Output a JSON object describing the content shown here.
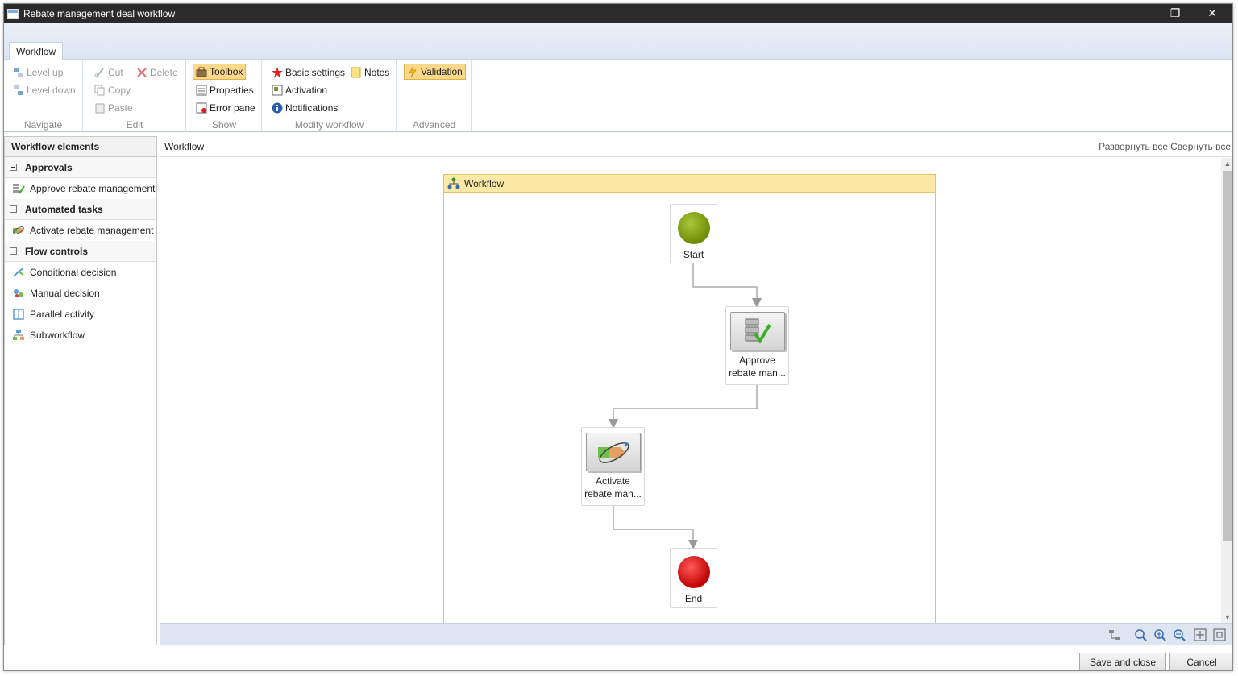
{
  "window": {
    "title": "Rebate management deal workflow"
  },
  "ribbon": {
    "tab": "Workflow",
    "navigate": {
      "label": "Navigate",
      "level_up": "Level up",
      "level_down": "Level down"
    },
    "edit": {
      "label": "Edit",
      "cut": "Cut",
      "delete": "Delete",
      "copy": "Copy",
      "paste": "Paste"
    },
    "show": {
      "label": "Show",
      "toolbox": "Toolbox",
      "properties": "Properties",
      "error_pane": "Error pane"
    },
    "modify": {
      "label": "Modify workflow",
      "basic_settings": "Basic settings",
      "notes": "Notes",
      "activation": "Activation",
      "notifications": "Notifications"
    },
    "advanced": {
      "label": "Advanced",
      "validation": "Validation"
    }
  },
  "elements_panel": {
    "title": "Workflow elements",
    "categories": [
      {
        "name": "Approvals",
        "items": [
          "Approve rebate management"
        ]
      },
      {
        "name": "Automated tasks",
        "items": [
          "Activate rebate management deal"
        ]
      },
      {
        "name": "Flow controls",
        "items": [
          "Conditional decision",
          "Manual decision",
          "Parallel activity",
          "Subworkflow"
        ]
      }
    ]
  },
  "main": {
    "title": "Workflow",
    "expand_all": "Развернуть все",
    "collapse_all": "Свернуть все",
    "frame_title": "Workflow",
    "nodes": {
      "start": "Start",
      "approve_line1": "Approve",
      "approve_line2": "rebate man...",
      "activate_line1": "Activate",
      "activate_line2": "rebate man...",
      "end": "End"
    }
  },
  "footer": {
    "save_close": "Save and close",
    "cancel": "Cancel"
  },
  "colors": {
    "start": "#7a9a08",
    "end": "#cc0000",
    "selected": "#fcd98a",
    "frame_head": "#fde9a6"
  }
}
